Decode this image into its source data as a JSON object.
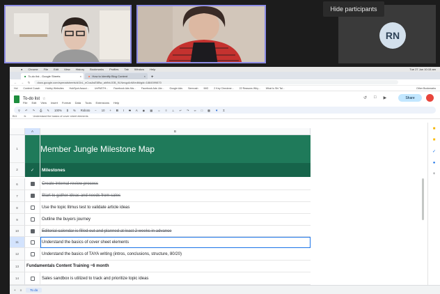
{
  "meeting": {
    "hide_participants_label": "Hide participants",
    "participant_initials": "RN"
  },
  "mac_menu": {
    "items": [
      "Chrome",
      "File",
      "Edit",
      "View",
      "History",
      "Bookmarks",
      "Profiles",
      "Tab",
      "Window",
      "Help"
    ],
    "clock": "Tue 27 Jun 10:15 am"
  },
  "browser": {
    "tabs": [
      {
        "label": "To-do list - Google Sheets",
        "active": true
      },
      {
        "label": "How to Identify Blog Content",
        "active": false
      }
    ],
    "url": "docs.google.com/spreadsheets/d/1bL_eCvaAsE6Bw_ahfbbJGB_9LNmqpAnM/edit#gid=1884599870",
    "bookmarks": [
      "Hol",
      "Content Coach",
      "Hubby Websites",
      "HubSpot Associ...",
      "UnPASTH...",
      "Facebook Ads Ma...",
      "Facebook Ads Libr...",
      "Google Ads",
      "Semrush",
      "IMG",
      "2 Key Checkme...",
      "22 Reasons Why...",
      "What Is Shi Tal...",
      "Other Bookmarks"
    ]
  },
  "sheet": {
    "title": "To-do list",
    "menu": [
      "File",
      "Edit",
      "View",
      "Insert",
      "Format",
      "Data",
      "Tools",
      "Extensions",
      "Help"
    ],
    "share_label": "Share",
    "toolbar": {
      "zoom": "100%",
      "font": "Roboto",
      "font_size": "10"
    },
    "cell_ref": "B11",
    "formula": "Understand the basics of cover sheet elements",
    "columns": [
      "A",
      "B"
    ],
    "sheet_tab": "To do",
    "rows": [
      {
        "num": "1",
        "kind": "title",
        "text": "Member Jungle Milestone Map"
      },
      {
        "num": "2",
        "kind": "milestones",
        "text": "Milestones"
      },
      {
        "num": "6",
        "kind": "task",
        "checked": true,
        "text": "Create internal review process"
      },
      {
        "num": "7",
        "kind": "task",
        "checked": true,
        "text": "Start to gather ideas and needs from sales"
      },
      {
        "num": "8",
        "kind": "task",
        "checked": false,
        "text": "Use the topic litmus test to validate article ideas"
      },
      {
        "num": "9",
        "kind": "task",
        "checked": false,
        "text": "Outline the buyers journey"
      },
      {
        "num": "10",
        "kind": "task",
        "checked": true,
        "text": "Editorial calendar is filled out and planned at least 2 weeks in advance"
      },
      {
        "num": "11",
        "kind": "task",
        "checked": false,
        "text": "Understand the basics of cover sheet elements",
        "selected": true
      },
      {
        "num": "12",
        "kind": "task",
        "checked": false,
        "text": "Understand the basics of TAYA writing (intros, conclusions, structure, 80/20)"
      },
      {
        "num": "13",
        "kind": "section",
        "text": "Fundamentals Content Training ~6 month"
      },
      {
        "num": "14",
        "kind": "task",
        "checked": false,
        "text": "Sales sandbox is utilized to track and prioritize topic ideas"
      }
    ]
  }
}
